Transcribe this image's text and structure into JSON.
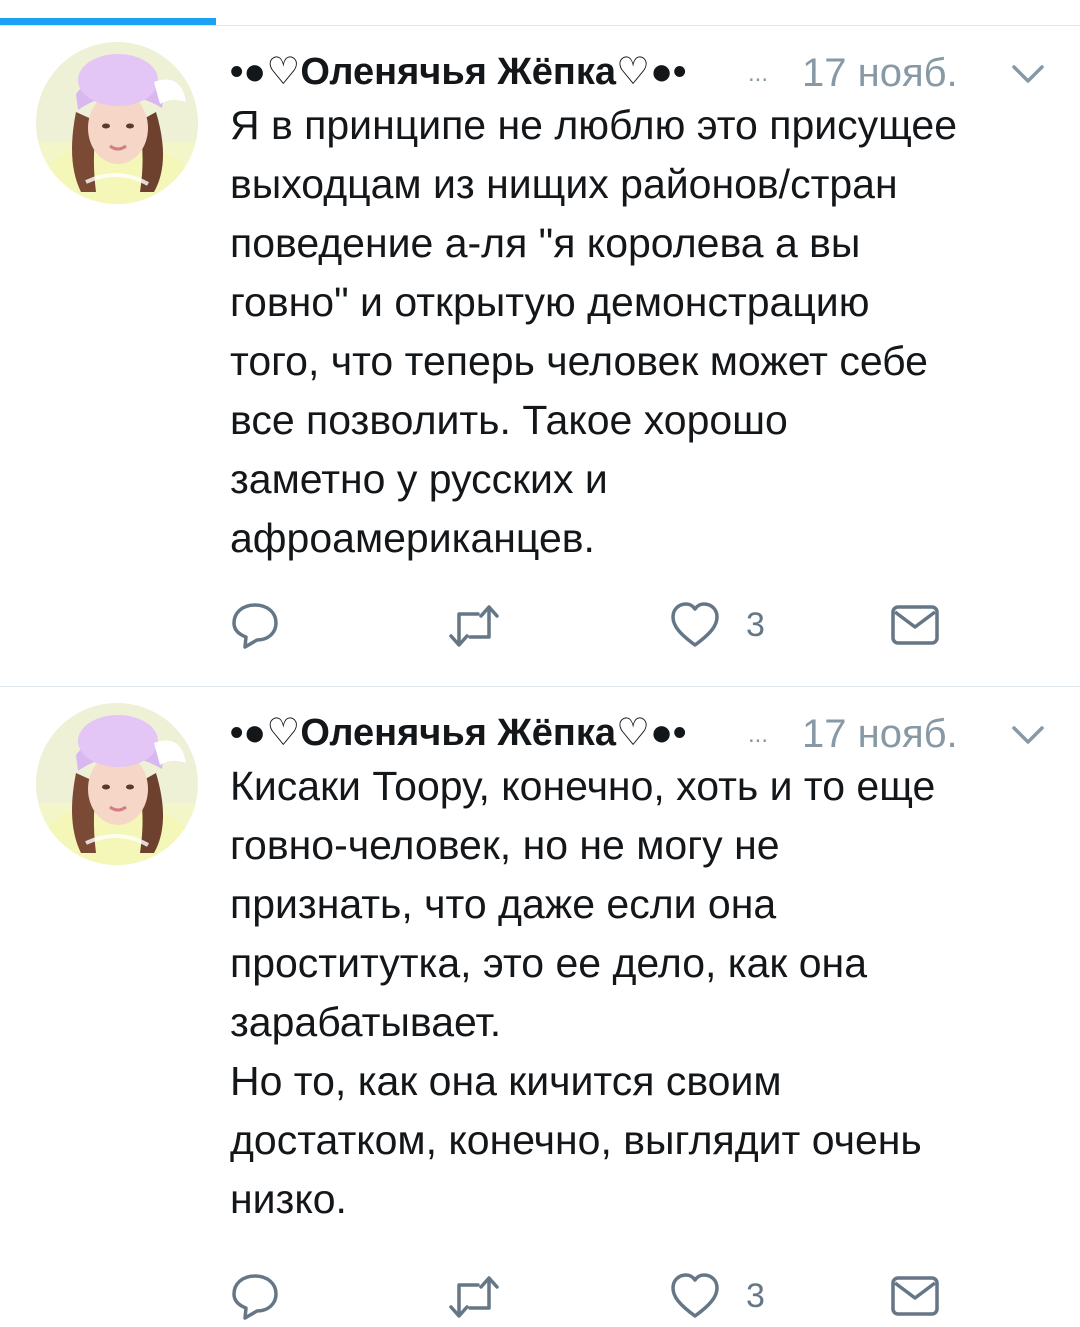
{
  "colors": {
    "accent": "#1da1f2",
    "text": "#14171a",
    "secondary": "#8899a6",
    "icon": "#657786",
    "divider": "#e1e8ed"
  },
  "tweets": [
    {
      "display_name": "•●♡Оленячья Жёпка♡●•",
      "handle": "...",
      "time": "17 нояб.",
      "text": "Я в принципе не люблю это присущее\nвыходцам из нищих районов/стран\nповедение а-ля \"я королева а вы\nговно\" и открытую демонстрацию\nтого, что теперь человек может себе\nвсе позволить. Такое хорошо\nзаметно у русских и\nафроамериканцев.",
      "like_count": "3",
      "icons": [
        "reply-icon",
        "retweet-icon",
        "heart-icon",
        "envelope-icon",
        "chevron-down-icon"
      ]
    },
    {
      "display_name": "•●♡Оленячья Жёпка♡●•",
      "handle": "...",
      "time": "17 нояб.",
      "text": "Кисаки Тоору, конечно, хоть и то еще\nговно-человек, но не могу не\nпризнать, что даже если она\nпроститутка, это ее дело, как она\nзарабатывает.\nНо то, как она кичится своим\nдостатком, конечно, выглядит очень\nнизко.",
      "like_count": "3",
      "icons": [
        "reply-icon",
        "retweet-icon",
        "heart-icon",
        "envelope-icon",
        "chevron-down-icon"
      ]
    }
  ]
}
